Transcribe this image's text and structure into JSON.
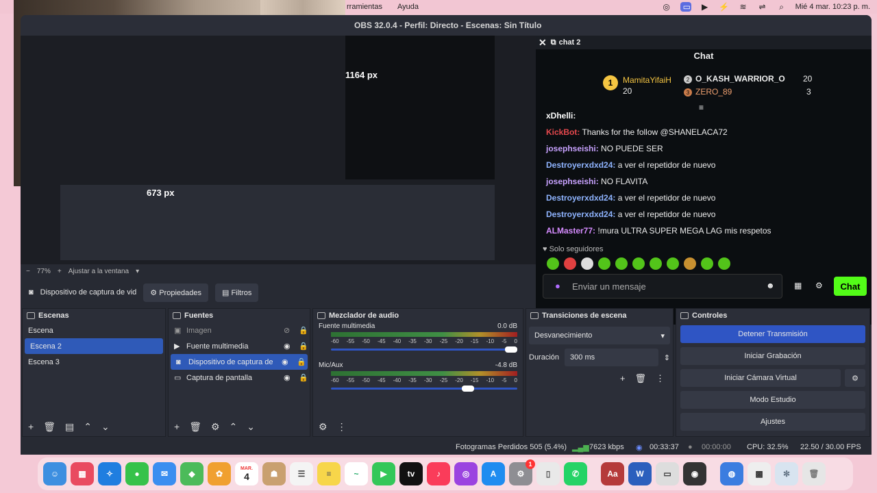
{
  "menubar": {
    "items": [
      "rramientas",
      "Ayuda"
    ],
    "datetime": "Mié 4 mar.  10:23 p. m."
  },
  "window": {
    "title": "OBS 32.0.4 - Perfil: Directo - Escenas: Sin Título"
  },
  "preview": {
    "zoom": "77%",
    "fit_label": "Ajustar a la ventana",
    "size_overlay_1": "1164 px",
    "size_overlay_2": "673 px"
  },
  "chat": {
    "dock_title": "chat 2",
    "title": "Chat",
    "leaderboard": [
      {
        "rank": "1",
        "user": "MamitaYifaiH",
        "points": "20"
      },
      {
        "rank": "2",
        "user": "O_KASH_WARRIOR_O",
        "points": "20"
      },
      {
        "rank": "3",
        "user": "ZERO_89",
        "points": "3"
      }
    ],
    "messages": [
      {
        "user": "xDhelli:",
        "text": "",
        "color": "#ffffff"
      },
      {
        "user": "KickBot:",
        "text": " Thanks for the follow @SHANELACA72",
        "color": "#e5484d"
      },
      {
        "user": "josephseishi:",
        "text": " NO PUEDE SER",
        "color": "#c8a2ff"
      },
      {
        "user": "Destroyerxdxd24:",
        "text": " a ver el repetidor de nuevo",
        "color": "#8fb4ff"
      },
      {
        "user": "josephseishi:",
        "text": " NO FLAVITA",
        "color": "#c8a2ff"
      },
      {
        "user": "Destroyerxdxd24:",
        "text": " a ver el repetidor de nuevo",
        "color": "#8fb4ff"
      },
      {
        "user": "Destroyerxdxd24:",
        "text": " a ver el repetidor de nuevo",
        "color": "#8fb4ff"
      },
      {
        "user": "ALMaster77:",
        "text": " !mura ULTRA SUPER MEGA LAG mis respetos",
        "color": "#d68cff"
      }
    ],
    "followers_only": "Solo seguidores",
    "input_placeholder": "Enviar un mensaje",
    "send_label": "Chat"
  },
  "source_bar": {
    "source_name": "Dispositivo de captura de vid",
    "properties": "Propiedades",
    "filters": "Filtros"
  },
  "scenes": {
    "title": "Escenas",
    "items": [
      "Escena",
      "Escena 2",
      "Escena 3"
    ]
  },
  "sources": {
    "title": "Fuentes",
    "items": [
      "Imagen",
      "Fuente multimedia",
      "Dispositivo de captura de",
      "Captura de pantalla"
    ]
  },
  "mixer": {
    "title": "Mezclador de audio",
    "channels": [
      {
        "name": "Fuente multimedia",
        "db": "0.0 dB",
        "volume_fraction": 1.0
      },
      {
        "name": "Mic/Aux",
        "db": "-4.8 dB",
        "volume_fraction": 0.77
      }
    ],
    "scale": [
      "-60",
      "-55",
      "-50",
      "-45",
      "-40",
      "-35",
      "-30",
      "-25",
      "-20",
      "-15",
      "-10",
      "-5",
      "0"
    ]
  },
  "transitions": {
    "title": "Transiciones de escena",
    "selected": "Desvanecimiento",
    "duration_label": "Duración",
    "duration_value": "300 ms"
  },
  "controls": {
    "title": "Controles",
    "stop_stream": "Detener Transmisión",
    "start_recording": "Iniciar Grabación",
    "virtual_cam": "Iniciar Cámara Virtual",
    "studio_mode": "Modo Estudio",
    "settings": "Ajustes"
  },
  "status": {
    "dropped": "Fotogramas Perdidos 505 (5.4%)",
    "bitrate": "7623 kbps",
    "stream_time": "00:33:37",
    "rec_time": "00:00:00",
    "cpu": "CPU: 32.5%",
    "fps": "22.50 / 30.00 FPS"
  },
  "dock": {
    "calendar_month": "MAR.",
    "calendar_day": "4",
    "badge": "1",
    "dict_label": "Aa",
    "word_label": "W",
    "tv_label": "tv"
  }
}
